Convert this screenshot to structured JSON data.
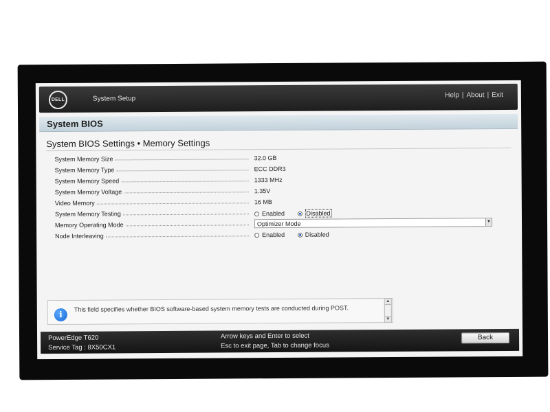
{
  "header": {
    "logo_text": "DELL",
    "app_title": "System Setup",
    "links": [
      {
        "label": "Help"
      },
      {
        "label": "About"
      },
      {
        "label": "Exit"
      }
    ],
    "separator": "|"
  },
  "section": {
    "title": "System BIOS"
  },
  "page": {
    "title": "System BIOS Settings • Memory Settings"
  },
  "settings": [
    {
      "label": "System Memory Size",
      "value": "32.0 GB"
    },
    {
      "label": "System Memory Type",
      "value": "ECC DDR3"
    },
    {
      "label": "System Memory Speed",
      "value": "1333 MHz"
    },
    {
      "label": "System Memory Voltage",
      "value": "1.35V"
    },
    {
      "label": "Video Memory",
      "value": "16 MB"
    },
    {
      "label": "System Memory Testing",
      "options": [
        "Enabled",
        "Disabled"
      ],
      "selected": "Disabled"
    },
    {
      "label": "Memory Operating Mode",
      "select_value": "Optimizer Mode"
    },
    {
      "label": "Node Interleaving",
      "options": [
        "Enabled",
        "Disabled"
      ],
      "selected": "Disabled"
    }
  ],
  "help": {
    "text": "This field specifies whether BIOS software-based system memory tests are conducted during POST.",
    "icon": "info-icon"
  },
  "footer": {
    "model": "PowerEdge T620",
    "service_tag": "Service Tag : 8X50CX1",
    "hint_line1": "Arrow keys and Enter to select",
    "hint_line2": "Esc to exit page, Tab to change focus",
    "back_label": "Back"
  }
}
